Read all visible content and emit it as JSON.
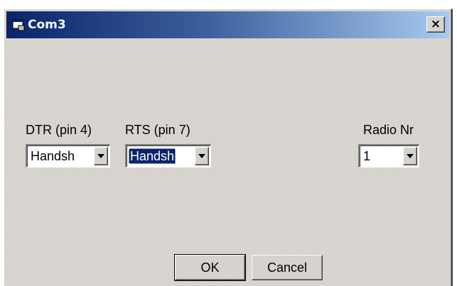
{
  "window": {
    "title": "Com3",
    "close_glyph": "×"
  },
  "fields": {
    "dtr": {
      "label": "DTR (pin 4)",
      "value": "Handsh"
    },
    "rts": {
      "label": "RTS (pin 7)",
      "value": "Handsh"
    },
    "radio": {
      "label": "Radio Nr",
      "value": "1"
    }
  },
  "buttons": {
    "ok_label": "OK",
    "cancel_label": "Cancel"
  },
  "colors": {
    "titlebar_start": "#0a246a",
    "titlebar_end": "#a6caf0",
    "face": "#d6d3ce",
    "selection": "#0a246a"
  },
  "icons": {
    "title": "app-window-icon",
    "close": "close-icon",
    "dropdown": "chevron-down-icon"
  }
}
